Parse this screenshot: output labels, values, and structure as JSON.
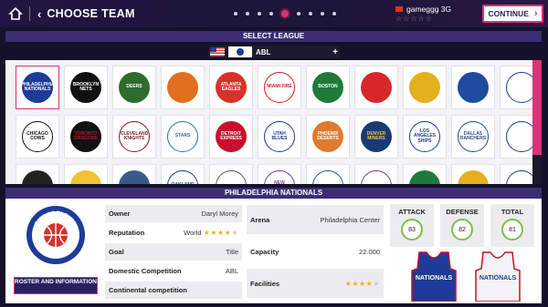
{
  "header": {
    "title": "CHOOSE TEAM",
    "pager_total": 9,
    "pager_active": 5,
    "username": "gameggg 3G",
    "user_stars": "☆☆☆☆☆",
    "continue_label": "CONTINUE"
  },
  "select_league": {
    "heading": "SELECT LEAGUE",
    "league_name": "ABL",
    "plus": "+"
  },
  "teams": [
    {
      "text": "PHILADELPHIA NATIONALS",
      "bg": "#1d3c9a",
      "fg": "#ffffff",
      "selected": true
    },
    {
      "text": "BROOKLYN NETS",
      "bg": "#111111",
      "fg": "#ffffff"
    },
    {
      "text": "DEERS",
      "bg": "#2f6a2f",
      "fg": "#ffffff"
    },
    {
      "text": "",
      "bg": "#e1701e",
      "fg": "#ffffff"
    },
    {
      "text": "ATLANTA EAGLES",
      "bg": "#d6322c",
      "fg": "#ffffff"
    },
    {
      "text": "MIAMI FIRE",
      "bg": "#ffffff",
      "fg": "#d0202a"
    },
    {
      "text": "BOSTON",
      "bg": "#1f7a3a",
      "fg": "#ffffff"
    },
    {
      "text": "",
      "bg": "#d8272c",
      "fg": "#ffffff"
    },
    {
      "text": "",
      "bg": "#e3b020",
      "fg": "#222222"
    },
    {
      "text": "",
      "bg": "#1e4aa0",
      "fg": "#ffffff"
    },
    {
      "text": "",
      "bg": "#ffffff",
      "fg": "#1d3c9a"
    },
    {
      "text": "CHICAGO COWS",
      "bg": "#ffffff",
      "fg": "#111111"
    },
    {
      "text": "TORONTO DRAGONS",
      "bg": "#111111",
      "fg": "#c8102e"
    },
    {
      "text": "CLEVELAND KNIGHTS",
      "bg": "#ffffff",
      "fg": "#7a1b2e"
    },
    {
      "text": "STARS",
      "bg": "#ffffff",
      "fg": "#2f6eb5"
    },
    {
      "text": "DETROIT EXPRESS",
      "bg": "#c8102e",
      "fg": "#ffffff"
    },
    {
      "text": "UTAH BLUES",
      "bg": "#ffffff",
      "fg": "#1e3a8a"
    },
    {
      "text": "PHOENIX DESERTS",
      "bg": "#e07a2e",
      "fg": "#ffffff"
    },
    {
      "text": "DENVER MINERS",
      "bg": "#1a3a73",
      "fg": "#f1c232"
    },
    {
      "text": "LOS ANGELES SHIPS",
      "bg": "#ffffff",
      "fg": "#1e3a8a"
    },
    {
      "text": "DALLAS RANCHERS",
      "bg": "#ffffff",
      "fg": "#2a4a8a"
    },
    {
      "text": "",
      "bg": "#ffffff",
      "fg": "#1e3a8a"
    },
    {
      "text": "",
      "bg": "#222222",
      "fg": "#ffffff"
    },
    {
      "text": "",
      "bg": "#f1c232",
      "fg": "#222222"
    },
    {
      "text": "",
      "bg": "#3a5a8a",
      "fg": "#ffffff"
    },
    {
      "text": "OAKLAND",
      "bg": "#ffffff",
      "fg": "#1e3a8a"
    },
    {
      "text": "",
      "bg": "#ffffff",
      "fg": "#555555"
    },
    {
      "text": "NEW ORLEANS",
      "bg": "#ffffff",
      "fg": "#7a3aa0"
    },
    {
      "text": "",
      "bg": "#ffffff",
      "fg": "#1e5aa0"
    },
    {
      "text": "",
      "bg": "#ffffff",
      "fg": "#7a3aa0"
    },
    {
      "text": "",
      "bg": "#1f7a3a",
      "fg": "#ffffff"
    },
    {
      "text": "",
      "bg": "#e3b020",
      "fg": "#222222"
    },
    {
      "text": "",
      "bg": "#ffffff",
      "fg": "#1e3a8a"
    }
  ],
  "team_info": {
    "heading": "PHILADELPHIA NATIONALS",
    "roster_button": "ROSTER AND INFORMATION",
    "logo_top_text": "PHILADELPHIA",
    "logo_bottom_text": "NATIONALS",
    "owner_label": "Owner",
    "owner_value": "Daryl Morey",
    "reputation_label": "Reputation",
    "reputation_value": "World",
    "reputation_stars": 4.5,
    "goal_label": "Goal",
    "goal_value": "Title",
    "domestic_label": "Domestic Competition",
    "domestic_value": "ABL",
    "continental_label": "Continental competition",
    "continental_value": "",
    "arena_label": "Arena",
    "arena_value": "Philadelphia Center",
    "capacity_label": "Capacity",
    "capacity_value": "22.000",
    "facilities_label": "Facilities",
    "facilities_stars": 4,
    "attack_label": "ATTACK",
    "attack_value": "83",
    "defense_label": "DEFENSE",
    "defense_value": "82",
    "total_label": "TOTAL",
    "total_value": "81",
    "jersey_text": "NATIONALS"
  },
  "colors": {
    "accent": "#e0307a",
    "header_bg": "#3b2e73",
    "navy": "#1d3c9a",
    "gauge": "#7cc04a"
  }
}
